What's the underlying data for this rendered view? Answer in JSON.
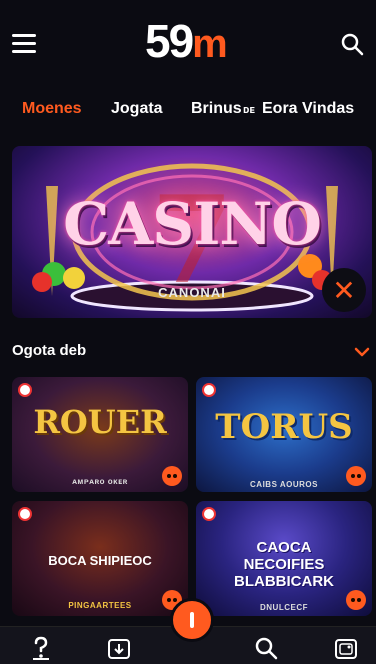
{
  "header": {
    "logo_number": "59",
    "logo_letter": "m"
  },
  "tabs": [
    {
      "label": "Moenes",
      "active": true
    },
    {
      "label": "Jogata",
      "active": false
    },
    {
      "label": "Brinus",
      "active": false
    },
    {
      "label": "ᴅᴇ",
      "active": false
    },
    {
      "label": "Eora Vindas",
      "active": false
    }
  ],
  "banner": {
    "title": "CASINO",
    "subtitle": "CANONAI"
  },
  "section": {
    "title": "Ogota deb"
  },
  "games": [
    {
      "title": "ROUER",
      "subtitle": "ᴀᴍᴘᴀʀᴏ ᴏᴋᴇʀ"
    },
    {
      "title": "TORUS",
      "subtitle": "CAIBS AOUROS"
    },
    {
      "title": "BOCA SHIPIEOC",
      "subtitle": "PINGAARTEES"
    },
    {
      "title": "CAOCA NECOIFIES BLABBICARK",
      "subtitle": "DNULCECF"
    }
  ],
  "colors": {
    "accent": "#ff5a1f",
    "background": "#0b0b12",
    "nav_background": "#14141c"
  },
  "bottom_nav": {
    "icons": [
      "help-icon",
      "download-icon",
      "center-action-icon",
      "search-icon",
      "gallery-icon"
    ]
  }
}
